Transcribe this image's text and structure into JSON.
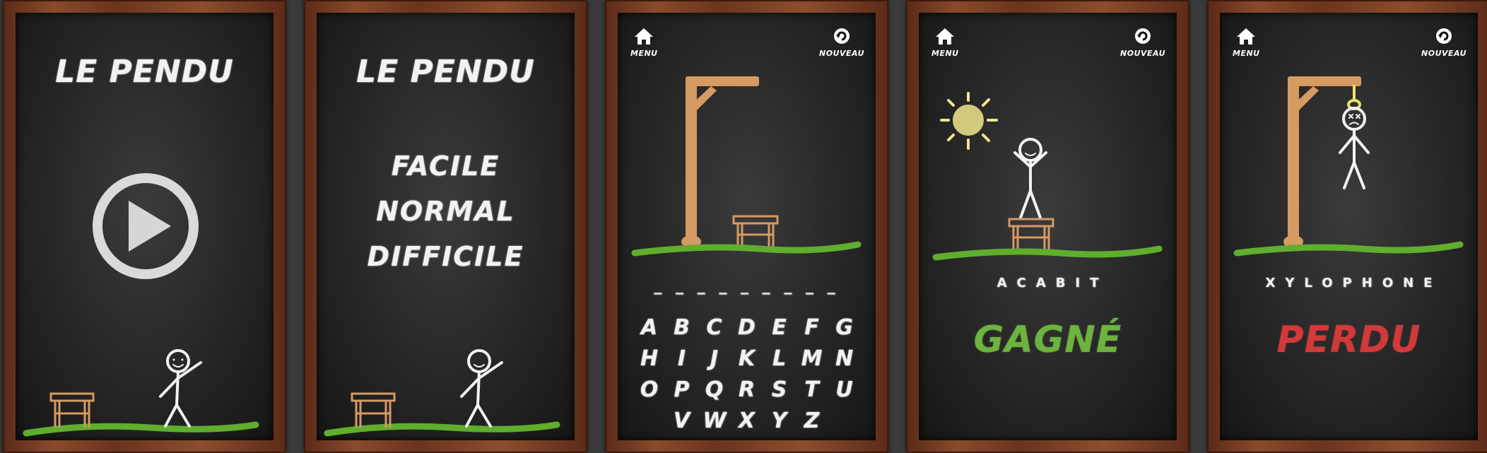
{
  "colors": {
    "chalk": "#f2f2f2",
    "win": "#6db33f",
    "lose": "#d23a3a",
    "wood": "#d69a63",
    "grass": "#5fae2e",
    "sun": "#f0e68c"
  },
  "screen1": {
    "title": "LE PENDU",
    "play_icon": "play-icon"
  },
  "screen2": {
    "title": "LE PENDU",
    "menu": [
      "FACILE",
      "NORMAL",
      "DIFFICILE"
    ]
  },
  "screen3": {
    "menu_label": "MENU",
    "new_label": "NOUVEAU",
    "blanks": "_ _ _ _ _ _ _ _ _",
    "keyboard": [
      [
        "A",
        "B",
        "C",
        "D",
        "E",
        "F",
        "G"
      ],
      [
        "H",
        "I",
        "J",
        "K",
        "L",
        "M",
        "N"
      ],
      [
        "O",
        "P",
        "Q",
        "R",
        "S",
        "T",
        "U"
      ],
      [
        "V",
        "W",
        "X",
        "Y",
        "Z"
      ]
    ]
  },
  "screen4": {
    "menu_label": "MENU",
    "new_label": "NOUVEAU",
    "word": "ACABIT",
    "result": "GAGNÉ"
  },
  "screen5": {
    "menu_label": "MENU",
    "new_label": "NOUVEAU",
    "word": "XYLOPHONE",
    "result": "PERDU"
  }
}
